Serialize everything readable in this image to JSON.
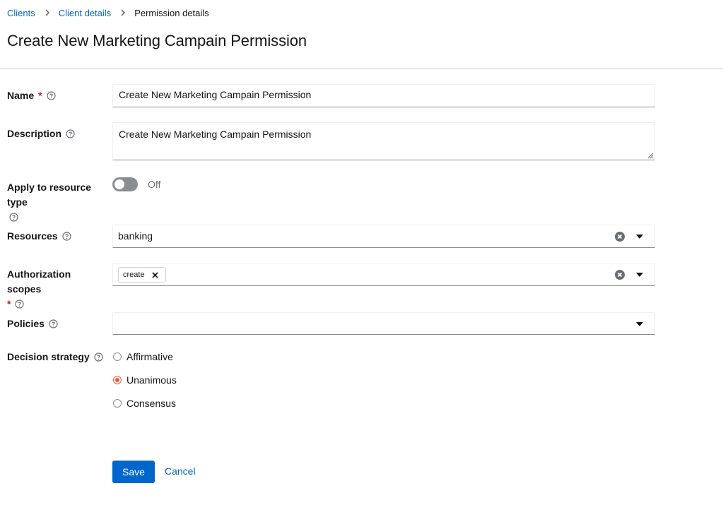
{
  "breadcrumb": {
    "items": [
      {
        "label": "Clients"
      },
      {
        "label": "Client details"
      },
      {
        "label": "Permission details"
      }
    ]
  },
  "page": {
    "title": "Create New Marketing Campain Permission"
  },
  "form": {
    "name": {
      "label": "Name",
      "required_mark": "*",
      "value": "Create New Marketing Campain Permission"
    },
    "description": {
      "label": "Description",
      "value": "Create New Marketing Campain Permission"
    },
    "apply_resource_type": {
      "label": "Apply to resource type",
      "state": "Off"
    },
    "resources": {
      "label": "Resources",
      "value": "banking"
    },
    "authorization_scopes": {
      "label": "Authorization scopes",
      "required_mark": "*",
      "chips": [
        "create"
      ]
    },
    "policies": {
      "label": "Policies",
      "value": ""
    },
    "decision_strategy": {
      "label": "Decision strategy",
      "options": [
        "Affirmative",
        "Unanimous",
        "Consensus"
      ],
      "selected": "Unanimous"
    }
  },
  "actions": {
    "save_label": "Save",
    "cancel_label": "Cancel"
  },
  "colors": {
    "primary": "#0066cc",
    "required": "#c9190b",
    "radio_selected": "#ee5a2f",
    "toggle_off": "#8a8d90"
  },
  "icons": {
    "help": "help-circle-icon",
    "clear": "times-circle-icon",
    "caret": "caret-down-icon",
    "chip_close": "times-icon",
    "breadcrumb_sep": "angle-right-icon"
  }
}
